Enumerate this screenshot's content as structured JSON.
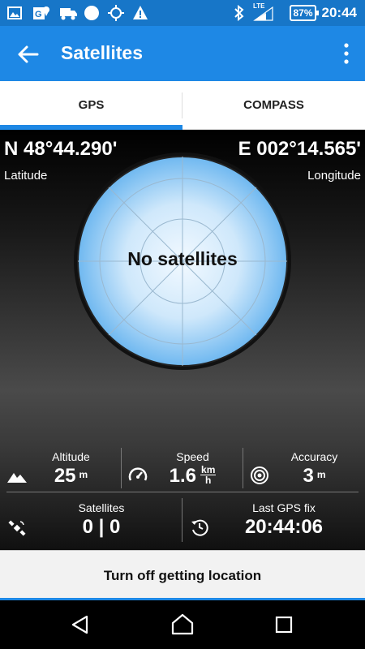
{
  "status_bar": {
    "time": "20:44",
    "battery": "87%",
    "network": "LTE",
    "icons": [
      "image-icon",
      "maps-icon",
      "car-icon",
      "circle-icon",
      "location-target-icon",
      "warning-icon",
      "bluetooth-icon",
      "signal-icon"
    ]
  },
  "appbar": {
    "title": "Satellites"
  },
  "tabs": [
    {
      "label": "GPS",
      "active": true
    },
    {
      "label": "COMPASS",
      "active": false
    }
  ],
  "position": {
    "latitude": "N 48°44.290'",
    "latitude_label": "Latitude",
    "longitude": "E 002°14.565'",
    "longitude_label": "Longitude"
  },
  "radar": {
    "message": "No satellites"
  },
  "stats": {
    "altitude": {
      "label": "Altitude",
      "value": "25",
      "unit": "m"
    },
    "speed": {
      "label": "Speed",
      "value": "1.6",
      "unit_num": "km",
      "unit_den": "h"
    },
    "accuracy": {
      "label": "Accuracy",
      "value": "3",
      "unit": "m"
    },
    "satellites": {
      "label": "Satellites",
      "value": "0 | 0"
    },
    "last_fix": {
      "label": "Last GPS fix",
      "value": "20:44:06"
    }
  },
  "action": {
    "label": "Turn off getting location"
  },
  "colors": {
    "status_bar": "#1776c8",
    "app_bar": "#1e88e5",
    "accent": "#1e88e5",
    "radar_center": "#f2f9ff",
    "radar_edge": "#6fb8f0"
  }
}
